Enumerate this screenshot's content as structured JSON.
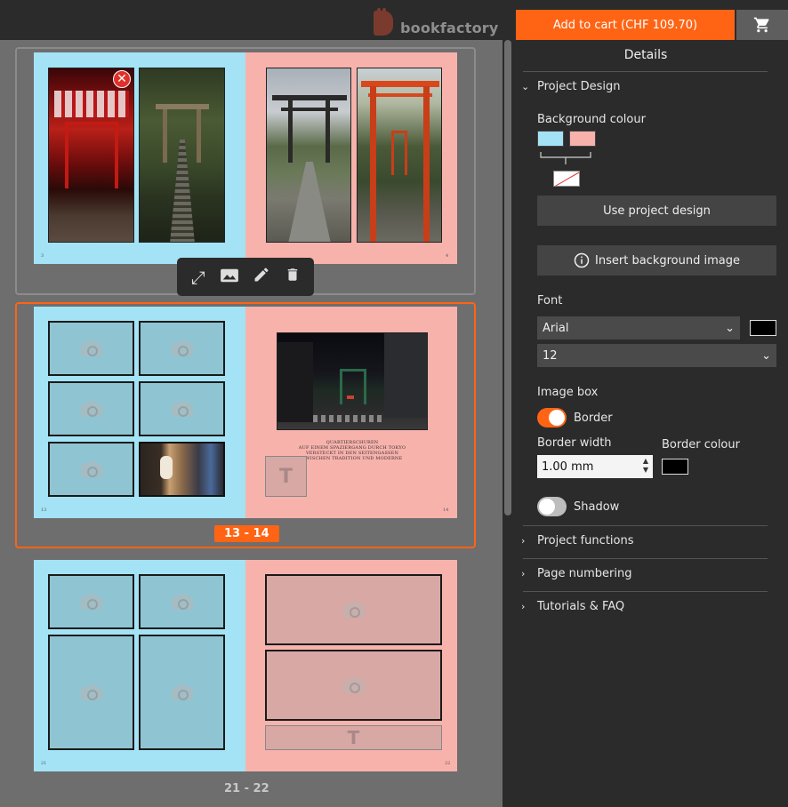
{
  "header": {
    "brand": "bookfactory",
    "cart_button_label": "Add to cart (CHF 109.70)",
    "cart_icon": "shopping-cart-icon",
    "accent_color": "#ff6414"
  },
  "canvas": {
    "spreads": [
      {
        "left_page_number": "3",
        "right_page_number": "4",
        "label": "",
        "toolbar_icons": [
          "expand-icon",
          "image-icon",
          "pencil-icon",
          "trash-icon"
        ]
      },
      {
        "left_page_number": "13",
        "right_page_number": "14",
        "label": "13 - 14",
        "caption": [
          "QUARTIERSCHUREN",
          "AUF EINEM SPAZIERGANG DURCH TOKYO",
          "VERSTECKT IN DEN SEITENGASSEN",
          "ZWISCHEN TRADITION UND MODERNE"
        ]
      },
      {
        "left_page_number": "21",
        "right_page_number": "22",
        "label": "21 - 22"
      }
    ],
    "colors": {
      "left_page": "#a3e3f5",
      "right_page": "#f8b2ac"
    }
  },
  "panel": {
    "title": "Details",
    "project_design": {
      "heading": "Project Design",
      "background_colour_label": "Background colour",
      "colors": [
        "#a3e3f5",
        "#f8b2ac"
      ],
      "use_project_design_label": "Use project design",
      "insert_background_label": "Insert background image",
      "font_label": "Font",
      "font_value": "Arial",
      "font_color": "#000000",
      "font_size_value": "12",
      "image_box_label": "Image box",
      "border_label": "Border",
      "border_on": true,
      "border_width_label": "Border width",
      "border_width_value": "1.00 mm",
      "border_colour_label": "Border colour",
      "border_color": "#000000",
      "shadow_label": "Shadow",
      "shadow_on": false
    },
    "sections": [
      "Project functions",
      "Page numbering",
      "Tutorials & FAQ"
    ]
  }
}
